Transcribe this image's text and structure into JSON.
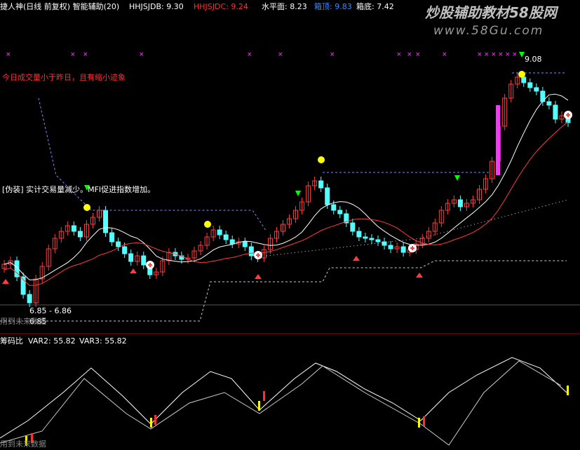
{
  "header": {
    "title": "捷人神(日线 前复权) 智能辅助(20)",
    "items": [
      {
        "label": "HHJSJDB: 9.30",
        "color": "#ffffff"
      },
      {
        "label": "HHJSJDC: 9.24",
        "color": "#ff3030"
      },
      {
        "label": "水平面: 8.23",
        "color": "#ffffff"
      },
      {
        "label": "箱顶: 9.83",
        "color": "#3b8cff"
      },
      {
        "label": "箱底: 7.42",
        "color": "#ffffff"
      }
    ]
  },
  "watermark": {
    "line1": "炒股辅助教材58股网",
    "line2": "www.58Gu.com"
  },
  "annotations": {
    "note1": "今日成交量小于昨日，且有缩小迹象",
    "note2": "[伪装] 实计交易量减少。MFI促进指数增加。",
    "peak_value": "9.08",
    "range_label": "6.85 - 6.86",
    "low_value": "6.85",
    "future_label_main": "用到未来数据"
  },
  "sub_panel": {
    "title": "筹码比",
    "items": [
      {
        "label": "VAR2: 55.82",
        "color": "#ffffff"
      },
      {
        "label": "VAR3: 55.82",
        "color": "#ffffff"
      }
    ],
    "future_label": "用到未来数据"
  },
  "colors": {
    "up": "#ff3b3b",
    "down": "#54ffff",
    "ma_white": "#ffffff",
    "ma_red": "#ff3b3b",
    "dashed": "#8888ff",
    "magenta": "#ff33ff",
    "yellow_dot": "#ffff00",
    "green_arrow": "#00ff00"
  }
}
